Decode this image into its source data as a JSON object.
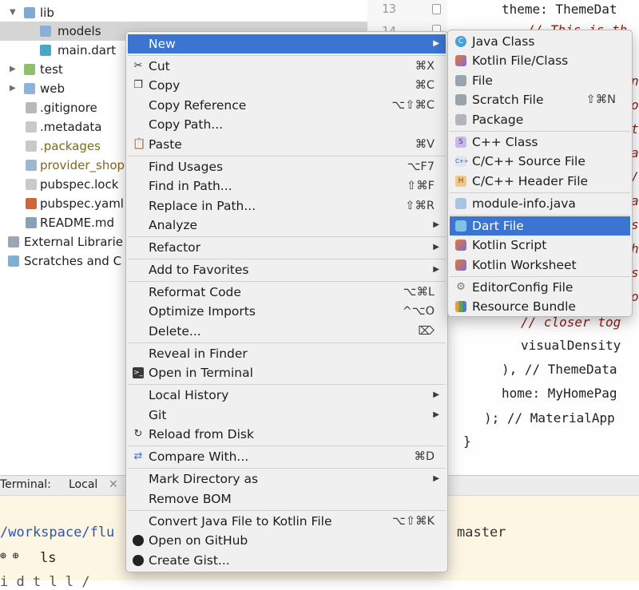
{
  "tree": {
    "items": [
      {
        "label": "lib",
        "type": "folder-open",
        "icon": "folder-icon"
      },
      {
        "label": "models",
        "type": "folder",
        "icon": "folder-icon",
        "selected": true
      },
      {
        "label": "main.dart",
        "type": "file",
        "icon": "dart-file-icon"
      },
      {
        "label": "test",
        "type": "folder",
        "icon": "test-folder-icon"
      },
      {
        "label": "web",
        "type": "folder",
        "icon": "web-folder-icon"
      },
      {
        "label": ".gitignore",
        "type": "file",
        "icon": "gitignore-icon"
      },
      {
        "label": ".metadata",
        "type": "file",
        "icon": "file-icon"
      },
      {
        "label": ".packages",
        "type": "file",
        "icon": "file-icon"
      },
      {
        "label": "provider_shop",
        "type": "file",
        "icon": "module-icon"
      },
      {
        "label": "pubspec.lock",
        "type": "file",
        "icon": "file-icon"
      },
      {
        "label": "pubspec.yaml",
        "type": "file",
        "icon": "yaml-icon"
      },
      {
        "label": "README.md",
        "type": "file",
        "icon": "markdown-icon"
      },
      {
        "label": "External Librarie",
        "type": "root",
        "icon": "libraries-icon"
      },
      {
        "label": "Scratches and C",
        "type": "root",
        "icon": "scratches-icon"
      }
    ]
  },
  "editor": {
    "line_numbers": [
      "13",
      "14"
    ],
    "lines": [
      {
        "text": "theme: ThemeDat",
        "kind": "code"
      },
      {
        "text": "// This is th",
        "kind": "comment"
      },
      {
        "text": "n",
        "kind": "comment"
      },
      {
        "text": "o",
        "kind": "comment"
      },
      {
        "text": "t",
        "kind": "comment"
      },
      {
        "text": "a",
        "kind": "comment"
      },
      {
        "text": "/",
        "kind": "comment"
      },
      {
        "text": "a",
        "kind": "comment"
      },
      {
        "text": "s",
        "kind": "comment"
      },
      {
        "text": "h",
        "kind": "comment"
      },
      {
        "text": "s",
        "kind": "comment"
      },
      {
        "text": "o",
        "kind": "comment"
      },
      {
        "text": "// closer tog",
        "kind": "comment"
      },
      {
        "text": "visualDensity",
        "kind": "code"
      },
      {
        "text": "), // ThemeData",
        "kind": "mixed"
      },
      {
        "text": "home: MyHomePag",
        "kind": "code"
      },
      {
        "text": "); // MaterialApp",
        "kind": "mixed"
      },
      {
        "text": "}",
        "kind": "code"
      }
    ]
  },
  "terminal": {
    "tab_label": "Terminal:",
    "session": "Local",
    "path": "/workspace/flu",
    "branch": "master",
    "command": "ls",
    "partial": "i  d  t  l  l  /"
  },
  "menu": {
    "items": [
      {
        "label": "New",
        "has_submenu": true,
        "highlighted": true
      },
      {
        "label": "Cut",
        "shortcut": "⌘X",
        "icon": "scissors-icon",
        "sep_before": true
      },
      {
        "label": "Copy",
        "shortcut": "⌘C",
        "icon": "copy-icon"
      },
      {
        "label": "Copy Reference",
        "shortcut": "⌥⇧⌘C"
      },
      {
        "label": "Copy Path..."
      },
      {
        "label": "Paste",
        "shortcut": "⌘V",
        "icon": "clipboard-icon"
      },
      {
        "label": "Find Usages",
        "shortcut": "⌥F7",
        "sep_before": true
      },
      {
        "label": "Find in Path...",
        "shortcut": "⇧⌘F"
      },
      {
        "label": "Replace in Path...",
        "shortcut": "⇧⌘R"
      },
      {
        "label": "Analyze",
        "has_submenu": true
      },
      {
        "label": "Refactor",
        "has_submenu": true,
        "sep_before": true
      },
      {
        "label": "Add to Favorites",
        "has_submenu": true,
        "sep_before": true
      },
      {
        "label": "Reformat Code",
        "shortcut": "⌥⌘L",
        "sep_before": true
      },
      {
        "label": "Optimize Imports",
        "shortcut": "^⌥O"
      },
      {
        "label": "Delete...",
        "shortcut": "⌦"
      },
      {
        "label": "Reveal in Finder",
        "sep_before": true
      },
      {
        "label": "Open in Terminal",
        "icon": "terminal-icon"
      },
      {
        "label": "Local History",
        "has_submenu": true,
        "sep_before": true
      },
      {
        "label": "Git",
        "has_submenu": true
      },
      {
        "label": "Reload from Disk",
        "icon": "reload-icon"
      },
      {
        "label": "Compare With...",
        "shortcut": "⌘D",
        "icon": "compare-icon",
        "sep_before": true
      },
      {
        "label": "Mark Directory as",
        "has_submenu": true,
        "sep_before": true
      },
      {
        "label": "Remove BOM"
      },
      {
        "label": "Convert Java File to Kotlin File",
        "shortcut": "⌥⇧⌘K",
        "sep_before": true
      },
      {
        "label": "Open on GitHub",
        "icon": "github-icon"
      },
      {
        "label": "Create Gist...",
        "icon": "github-icon"
      }
    ]
  },
  "submenu": {
    "items": [
      {
        "label": "Java Class",
        "icon": "java-class-icon"
      },
      {
        "label": "Kotlin File/Class",
        "icon": "kotlin-file-icon"
      },
      {
        "label": "File",
        "icon": "file-icon"
      },
      {
        "label": "Scratch File",
        "shortcut": "⇧⌘N",
        "icon": "scratch-file-icon"
      },
      {
        "label": "Package",
        "icon": "package-icon"
      },
      {
        "label": "C++ Class",
        "icon": "cpp-class-icon",
        "sep_before": true
      },
      {
        "label": "C/C++ Source File",
        "icon": "cpp-source-icon"
      },
      {
        "label": "C/C++ Header File",
        "icon": "cpp-header-icon"
      },
      {
        "label": "module-info.java",
        "icon": "module-info-icon",
        "sep_before": true
      },
      {
        "label": "Dart File",
        "icon": "dart-file-icon",
        "highlighted": true,
        "sep_before": true
      },
      {
        "label": "Kotlin Script",
        "icon": "kotlin-script-icon"
      },
      {
        "label": "Kotlin Worksheet",
        "icon": "kotlin-worksheet-icon"
      },
      {
        "label": "EditorConfig File",
        "icon": "gear-icon",
        "sep_before": true
      },
      {
        "label": "Resource Bundle",
        "icon": "resource-bundle-icon"
      }
    ]
  }
}
